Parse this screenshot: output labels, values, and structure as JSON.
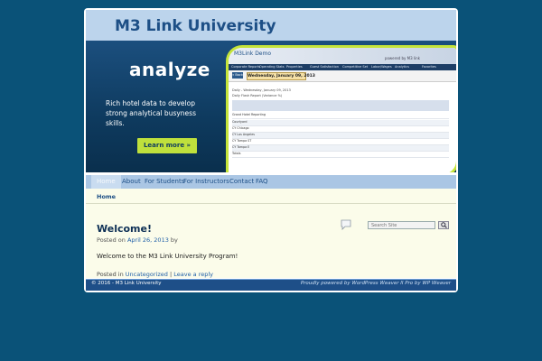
{
  "site": {
    "title": "M3 Link University"
  },
  "banner": {
    "heading": "analyze",
    "text": "Rich hotel data to develop strong analytical busyness skills.",
    "button_label": "Learn more »",
    "screenshot": {
      "logo": "M3Link Demo",
      "powered": "powered by M3 link",
      "tabs": [
        "Corporate Reports",
        "Operating Stats",
        "Properties",
        "Guest Satisfaction",
        "Competitive Set",
        "Labor/Wages",
        "Analytics",
        "Favorites"
      ],
      "back_label": "« Back",
      "date": "Wednesday, January 09, 2013",
      "line1": "Daily - Wednesday, January 09, 2013",
      "line2": "Daily Flash Report (Variance %)",
      "rows": [
        "Grand Hotel Reporting",
        "Courtyard",
        "CY Chicago",
        "CY Los Angeles",
        "CY Tampa ST",
        "CY Tampa E",
        "Totals"
      ]
    }
  },
  "nav": {
    "items": [
      "Home",
      "About",
      "For Students",
      "For Instructors",
      "Contact",
      "FAQ"
    ]
  },
  "breadcrumb": "Home",
  "post": {
    "title": "Welcome!",
    "meta_prefix": "Posted on",
    "date": "April 26, 2013",
    "meta_by": "by",
    "body": "Welcome to the M3 Link University Program!",
    "posted_in": "Posted in",
    "category": "Uncategorized",
    "divider": "|",
    "reply": "Leave a reply"
  },
  "search": {
    "placeholder": "Search Site"
  },
  "footer": {
    "left": "© 2016 - M3 Link University",
    "right": "Proudly powered by WordPress  Weaver II Pro by WP Weaver"
  },
  "colors": {
    "accent": "#bfe03c",
    "header_bg": "#bcd4ec",
    "page_bg": "#0a5278",
    "footer_bg": "#1e4f88"
  }
}
